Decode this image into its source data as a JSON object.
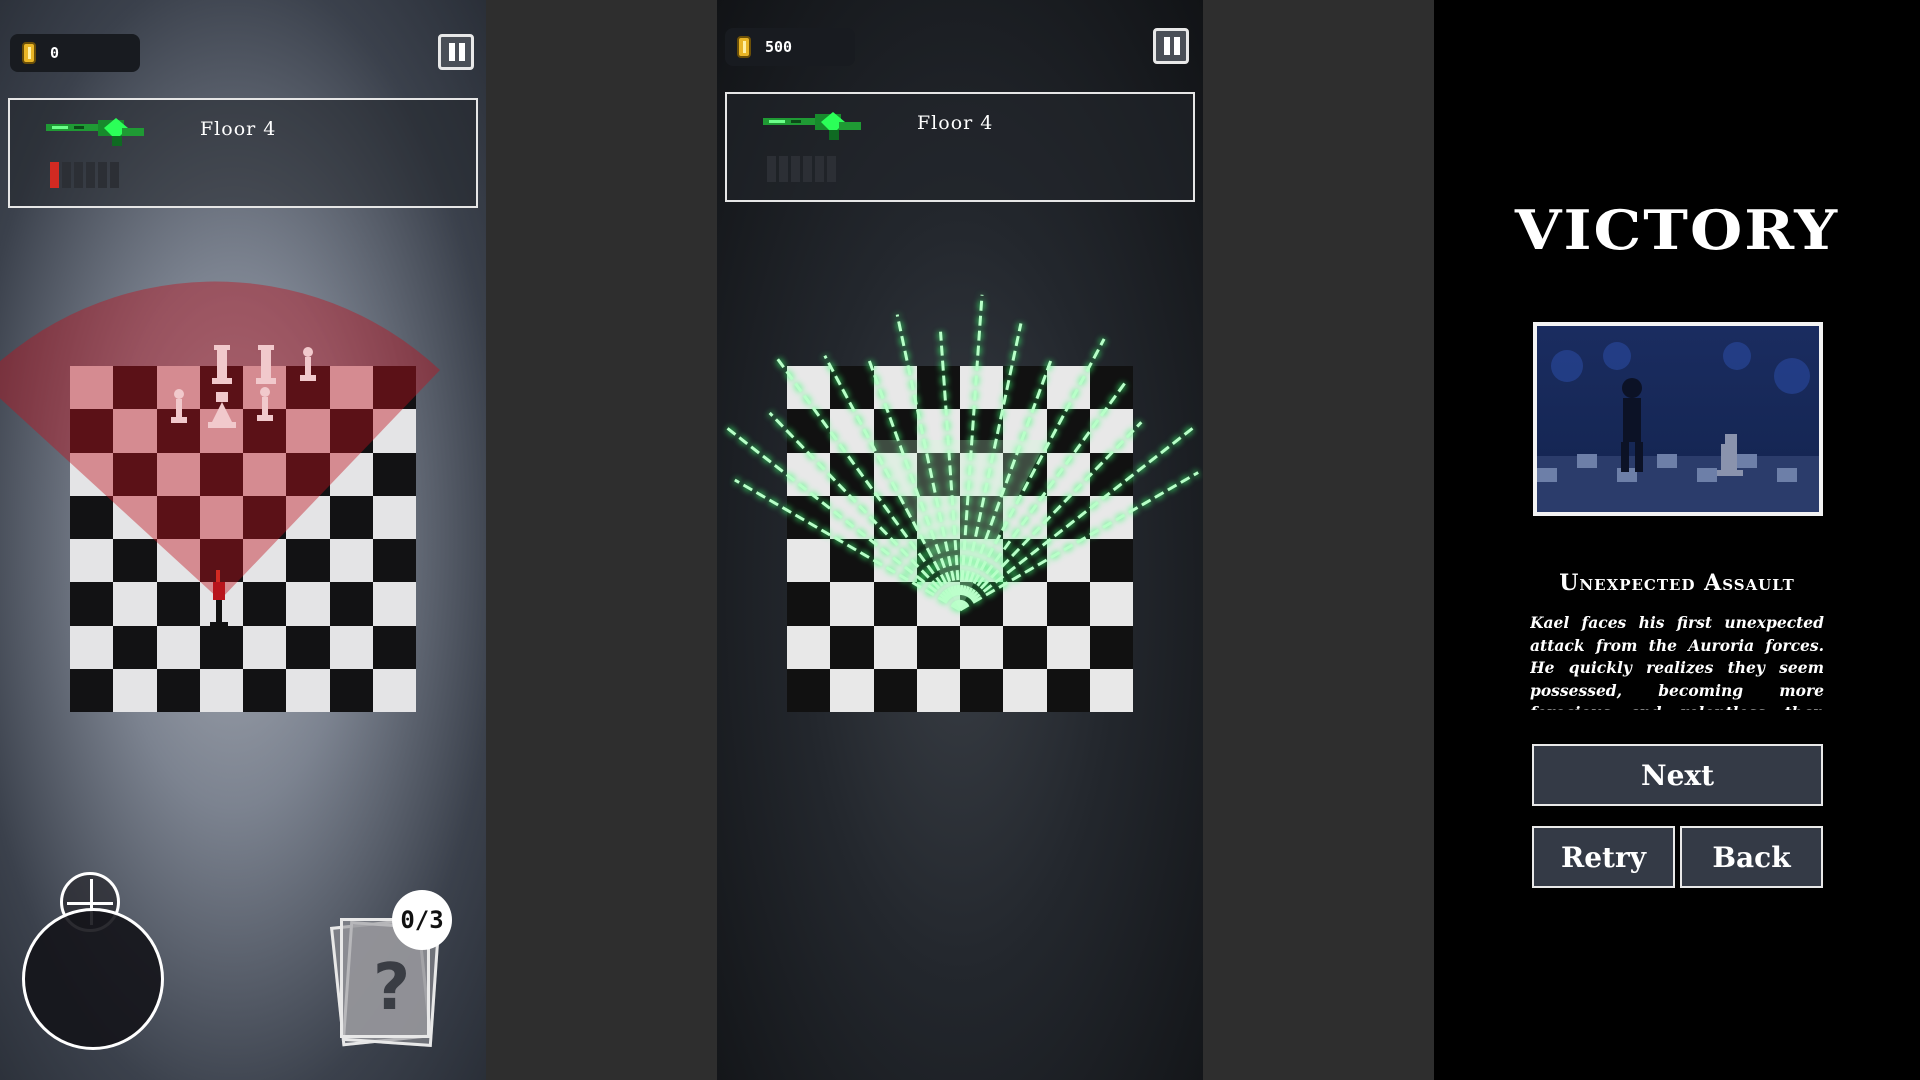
{
  "left_panel": {
    "coins": "0",
    "floor_label": "Floor 4",
    "ammo": {
      "total": 6,
      "loaded": 1
    },
    "card_counter": "0/3",
    "card_placeholder": "?"
  },
  "middle_panel": {
    "coins": "500",
    "floor_label": "Floor 4",
    "ammo": {
      "total": 6,
      "loaded": 0
    }
  },
  "right_panel": {
    "title": "VICTORY",
    "chapter_title": "Unexpected Assault",
    "story_text": "Kael faces his first unexpected attack from the Auroria forces. He quickly realizes they seem possessed, becoming more ferocious and relentless than before.",
    "buttons": {
      "next": "Next",
      "retry": "Retry",
      "back": "Back"
    }
  },
  "colors": {
    "coin": "#e9b526",
    "ammo_loaded": "#d22a22",
    "danger_zone": "#c0101c",
    "laser": "#38ff70",
    "board_light": "#e8e8e8",
    "board_dark": "#111111",
    "button_bg": "#343a46"
  },
  "icons": [
    "coin-icon",
    "pause-icon",
    "laser-rifle-icon",
    "crosshair-icon",
    "mystery-card-icon"
  ]
}
